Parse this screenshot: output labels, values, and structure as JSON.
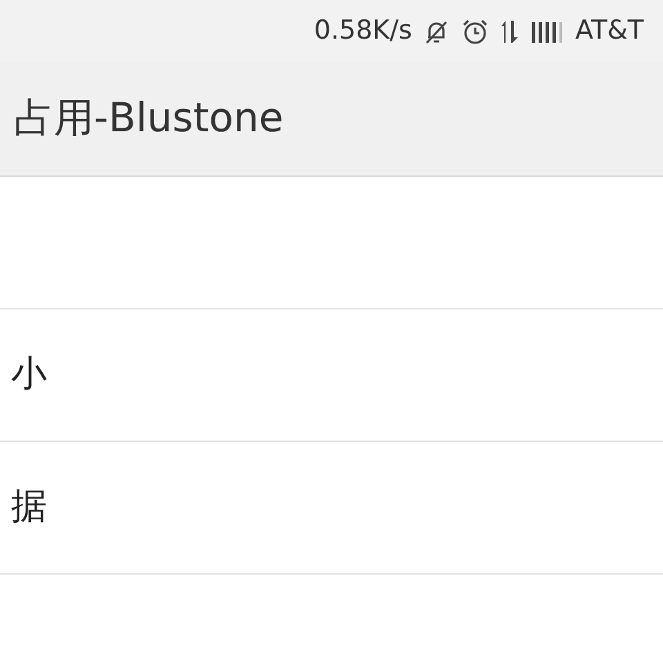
{
  "status_bar": {
    "speed": "0.58K/s",
    "carrier": "AT&T"
  },
  "header": {
    "title": "占用-Blustone"
  },
  "rows": [
    {
      "label": ""
    },
    {
      "label": "小"
    },
    {
      "label": "据"
    },
    {
      "label": ""
    }
  ]
}
